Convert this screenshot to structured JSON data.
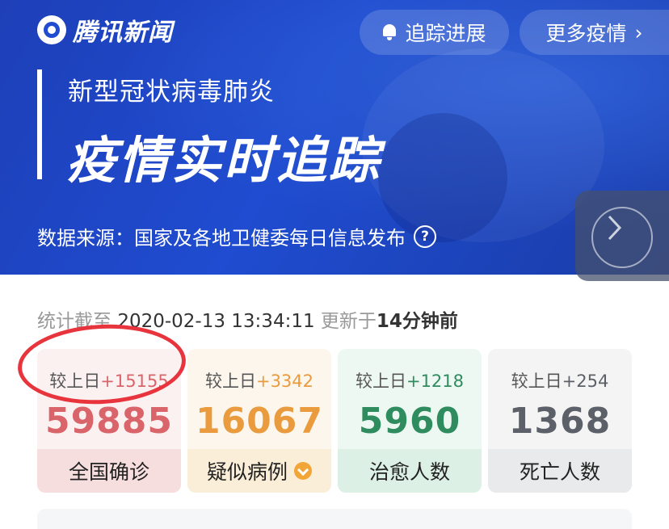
{
  "header": {
    "logo_text": "腾讯新闻",
    "track_button": "追踪进展",
    "more_button": "更多疫情",
    "more_chevron": "›"
  },
  "banner": {
    "subtitle": "新型冠状病毒肺炎",
    "title": "疫情实时追踪",
    "source": "数据来源：国家及各地卫健委每日信息发布",
    "help_glyph": "?"
  },
  "stats": {
    "prefix": "统计截至",
    "timestamp": "2020-02-13 13:34:11",
    "updated_prefix": "更新于",
    "updated_value": "14分钟前",
    "cards": [
      {
        "delta_label": "较上日",
        "delta_value": "+15155",
        "value": "59885",
        "label": "全国确诊",
        "color": "#d9646a",
        "delta_color": "#d9646a"
      },
      {
        "delta_label": "较上日",
        "delta_value": "+3342",
        "value": "16067",
        "label": "疑似病例",
        "color": "#e99b3e",
        "delta_color": "#e99b3e"
      },
      {
        "delta_label": "较上日",
        "delta_value": "+1218",
        "value": "5960",
        "label": "治愈人数",
        "color": "#2f8c5e",
        "delta_color": "#2f8c5e"
      },
      {
        "delta_label": "较上日",
        "delta_value": "+254",
        "value": "1368",
        "label": "死亡人数",
        "color": "#5c6068",
        "delta_color": "#5c6068"
      }
    ]
  },
  "colors": {
    "banner": "#1f4cd0",
    "annotation": "#e8343c"
  },
  "icons": {
    "logo": "tencent-news-logo",
    "track": "bell-icon",
    "help": "question-circle-icon",
    "next": "chevron-right-icon",
    "suspected": "check-badge-icon"
  }
}
